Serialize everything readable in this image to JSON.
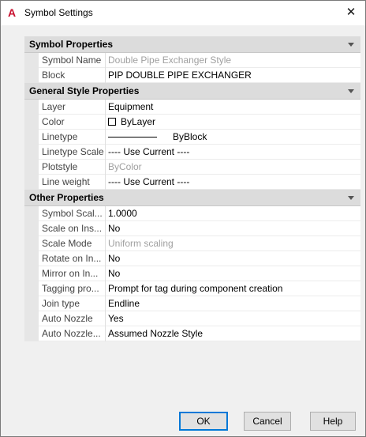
{
  "window": {
    "title": "Symbol Settings",
    "app_icon": "autocad-icon",
    "close_glyph": "✕"
  },
  "sections": [
    {
      "label": "Symbol Properties",
      "rows": [
        {
          "name": "Symbol Name",
          "value": "Double Pipe Exchanger Style",
          "disabled": true
        },
        {
          "name": "Block",
          "value": "PIP DOUBLE PIPE EXCHANGER",
          "disabled": false
        }
      ]
    },
    {
      "label": "General Style Properties",
      "rows": [
        {
          "name": "Layer",
          "value": "Equipment",
          "disabled": false
        },
        {
          "name": "Color",
          "value": "ByLayer",
          "disabled": false
        },
        {
          "name": "Linetype",
          "value": "ByBlock",
          "disabled": false
        },
        {
          "name": "Linetype Scale",
          "value": "---- Use Current ----",
          "disabled": false
        },
        {
          "name": "Plotstyle",
          "value": "ByColor",
          "disabled": true
        },
        {
          "name": "Line weight",
          "value": "---- Use Current ----",
          "disabled": false
        }
      ]
    },
    {
      "label": "Other Properties",
      "rows": [
        {
          "name": "Symbol Scal...",
          "value": "1.0000",
          "disabled": false
        },
        {
          "name": "Scale on Ins...",
          "value": "No",
          "disabled": false
        },
        {
          "name": "Scale Mode",
          "value": "Uniform scaling",
          "disabled": true
        },
        {
          "name": "Rotate on In...",
          "value": "No",
          "disabled": false
        },
        {
          "name": "Mirror on In...",
          "value": "No",
          "disabled": false
        },
        {
          "name": "Tagging pro...",
          "value": "Prompt for tag during component creation",
          "disabled": false
        },
        {
          "name": "Join type",
          "value": "Endline",
          "disabled": false
        },
        {
          "name": "Auto Nozzle",
          "value": "Yes",
          "disabled": false
        },
        {
          "name": "Auto Nozzle...",
          "value": "Assumed Nozzle Style",
          "disabled": false
        }
      ]
    }
  ],
  "buttons": {
    "ok": "OK",
    "cancel": "Cancel",
    "help": "Help"
  },
  "colors": {
    "ok_border": "#0078d7",
    "section_bg": "#dcdcdc",
    "disabled_text": "#a0a0a0"
  }
}
